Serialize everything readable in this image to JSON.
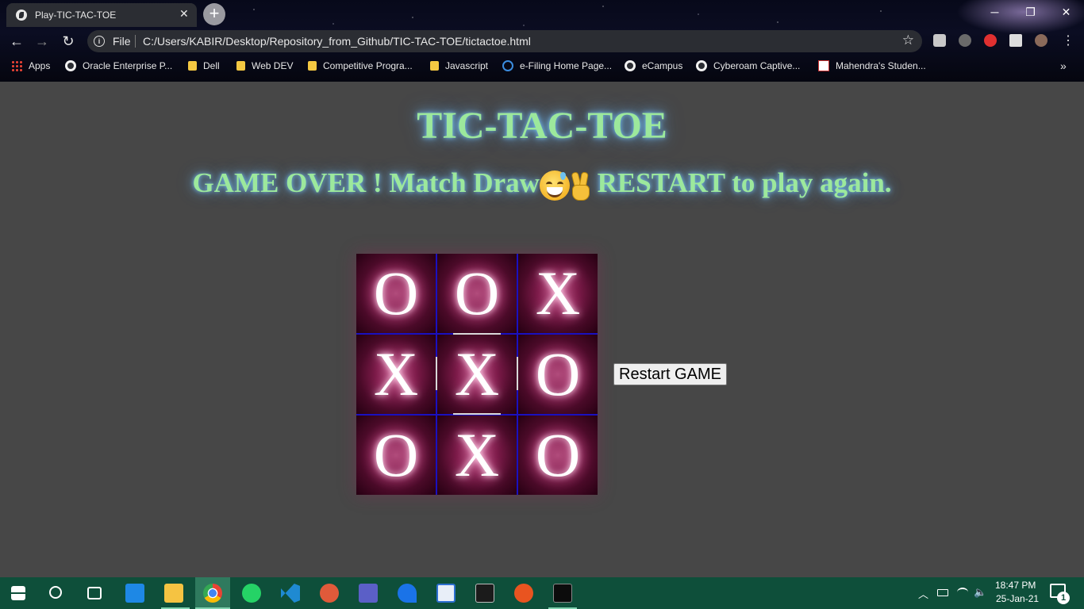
{
  "browser": {
    "tab_title": "Play-TIC-TAC-TOE",
    "tab_close": "✕",
    "new_tab": "+",
    "window_controls": {
      "minimize": "─",
      "restore": "❐",
      "close": "✕"
    },
    "nav": {
      "back": "←",
      "forward": "→",
      "reload": "↻"
    },
    "omnibox": {
      "scheme": "File",
      "url": "C:/Users/KABIR/Desktop/Repository_from_Github/TIC-TAC-TOE/tictactoe.html",
      "star": "☆"
    },
    "menu": "⋮",
    "bookmarks": [
      {
        "label": "Apps",
        "icon": "apps-grid-icon"
      },
      {
        "label": "Oracle Enterprise P...",
        "icon": "globe-icon"
      },
      {
        "label": "Dell",
        "icon": "folder-icon"
      },
      {
        "label": "Web DEV",
        "icon": "folder-icon"
      },
      {
        "label": "Competitive Progra...",
        "icon": "folder-icon"
      },
      {
        "label": "Javascript",
        "icon": "folder-icon"
      },
      {
        "label": "e-Filing Home Page...",
        "icon": "efiling-icon"
      },
      {
        "label": "eCampus",
        "icon": "globe-icon"
      },
      {
        "label": "Cyberoam Captive...",
        "icon": "globe-icon"
      },
      {
        "label": "Mahendra's Studen...",
        "icon": "mahendra-icon"
      }
    ],
    "bookmarks_more": "»"
  },
  "game": {
    "title": "TIC-TAC-TOE",
    "status_prefix": "GAME OVER ! Match Draw",
    "status_suffix": " RESTART to play again.",
    "board": [
      [
        "O",
        "O",
        "X"
      ],
      [
        "X",
        "X",
        "O"
      ],
      [
        "O",
        "X",
        "O"
      ]
    ],
    "restart_label": "Restart GAME"
  },
  "taskbar": {
    "time": "18:47 PM",
    "date": "25-Jan-21",
    "notification_count": "1",
    "apps": [
      "windows-start-icon",
      "search-icon",
      "task-view-icon",
      "mail-icon",
      "file-explorer-icon",
      "chrome-icon",
      "whatsapp-icon",
      "vscode-icon",
      "gamepad-icon",
      "teams-icon",
      "edge-legacy-icon",
      "app-window-icon",
      "app-monitor-icon",
      "ubuntu-icon",
      "terminal-icon"
    ]
  },
  "colors": {
    "page_bg": "#474747",
    "title_green": "#9ce89c",
    "glow_blue": "#78c8ff",
    "cell_magenta": "#7e1b4a",
    "grid_blue": "#1a10c0",
    "taskbar_green": "#0e4f3a"
  }
}
